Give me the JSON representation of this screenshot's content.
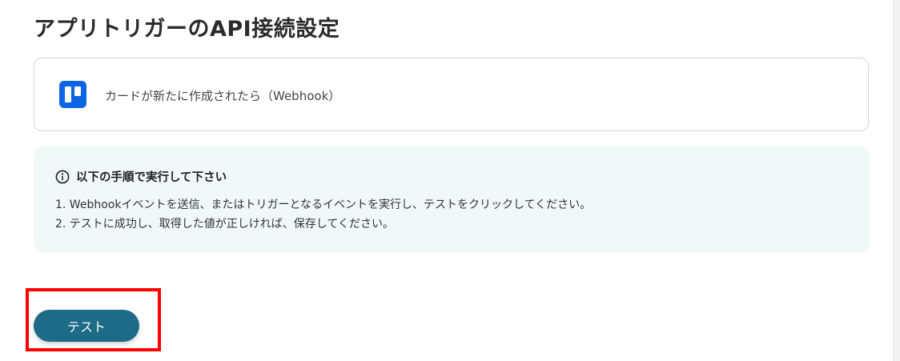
{
  "page": {
    "title": "アプリトリガーのAPI接続設定"
  },
  "trigger": {
    "app_icon": "trello-icon",
    "label": "カードが新たに作成されたら（Webhook）"
  },
  "instructions": {
    "icon": "info-circle-icon",
    "heading": "以下の手順で実行して下さい",
    "steps": [
      "1. Webhookイベントを送信、またはトリガーとなるイベントを実行し、テストをクリックしてください。",
      "2. テストに成功し、取得した値が正しければ、保存してください。"
    ]
  },
  "actions": {
    "test_label": "テスト"
  },
  "colors": {
    "accent": "#1d6b86",
    "info_background": "#f1f8f8",
    "trello_blue": "#0c66e4",
    "highlight": "#ff0000"
  }
}
